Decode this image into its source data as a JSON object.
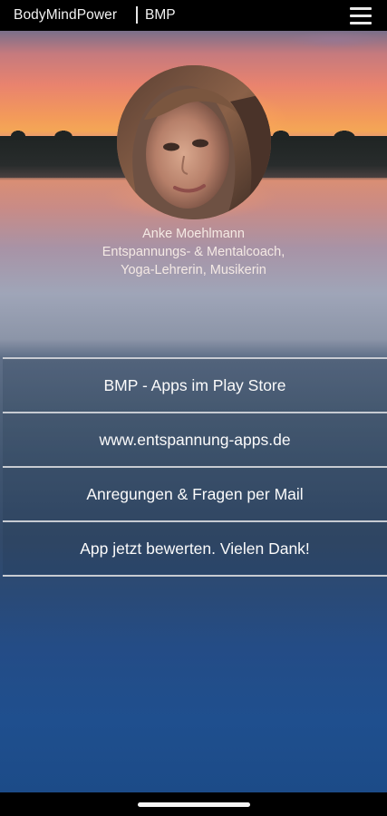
{
  "appbar": {
    "title": "BodyMindPower",
    "subtitle": "BMP"
  },
  "profile": {
    "name": "Anke Moehlmann",
    "role_line1": "Entspannungs- & Mentalcoach,",
    "role_line2": "Yoga-Lehrerin, Musikerin"
  },
  "menu": {
    "items": [
      {
        "label": "BMP - Apps im Play Store"
      },
      {
        "label": "www.entspannung-apps.de"
      },
      {
        "label": "Anregungen & Fragen per Mail"
      },
      {
        "label": "App jetzt bewerten. Vielen Dank!"
      }
    ]
  },
  "colors": {
    "appbar_bg": "#000000",
    "divider": "#c7cbd2",
    "profile_text": "#f4e9e4"
  },
  "icons": {
    "menu": "hamburger-icon"
  }
}
